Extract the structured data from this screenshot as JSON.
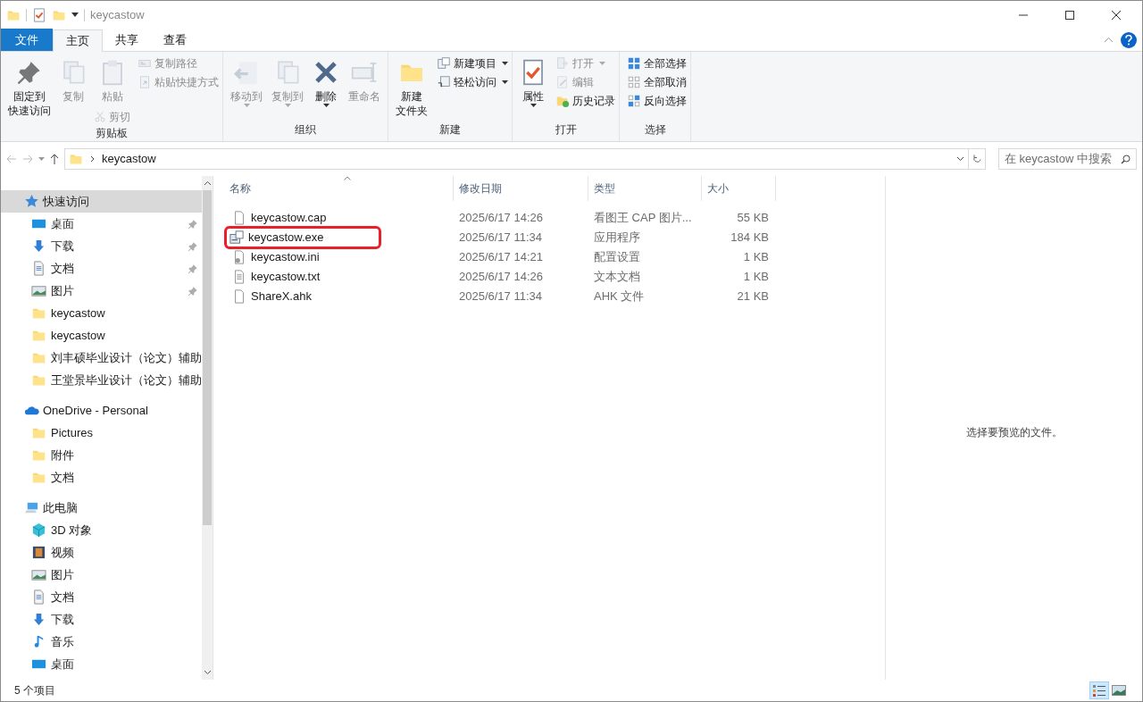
{
  "window": {
    "title": "keycastow"
  },
  "tabs": [
    {
      "label": "文件",
      "kind": "file",
      "selected": false
    },
    {
      "label": "主页",
      "kind": "tab",
      "selected": true
    },
    {
      "label": "共享",
      "kind": "tab",
      "selected": false
    },
    {
      "label": "查看",
      "kind": "tab",
      "selected": false
    }
  ],
  "ribbon": [
    {
      "label": "剪贴板",
      "items": [
        {
          "kind": "large",
          "label": [
            "固定到",
            "快速访问"
          ],
          "disabled": false,
          "dropdown": false
        },
        {
          "kind": "large",
          "label": [
            "复制"
          ],
          "disabled": true,
          "dropdown": false
        },
        {
          "kind": "large",
          "label": [
            "粘贴"
          ],
          "disabled": true,
          "dropdown": false,
          "sub": {
            "label": "剪切",
            "disabled": true
          }
        },
        {
          "kind": "smallcol",
          "items": [
            {
              "label": "复制路径",
              "disabled": true,
              "dropdown": false
            },
            {
              "label": "粘贴快捷方式",
              "disabled": true,
              "dropdown": false
            }
          ]
        }
      ]
    },
    {
      "label": "组织",
      "items": [
        {
          "kind": "large",
          "label": [
            "移动到"
          ],
          "disabled": true,
          "dropdown": true
        },
        {
          "kind": "large",
          "label": [
            "复制到"
          ],
          "disabled": true,
          "dropdown": true
        },
        {
          "kind": "large",
          "label": [
            "删除"
          ],
          "disabled": false,
          "dropdown": true
        },
        {
          "kind": "large",
          "label": [
            "重命名"
          ],
          "disabled": true,
          "dropdown": false
        }
      ]
    },
    {
      "label": "新建",
      "items": [
        {
          "kind": "large",
          "label": [
            "新建",
            "文件夹"
          ],
          "disabled": false,
          "dropdown": false
        },
        {
          "kind": "smallcol",
          "items": [
            {
              "label": "新建项目",
              "disabled": false,
              "dropdown": true
            },
            {
              "label": "轻松访问",
              "disabled": false,
              "dropdown": true
            }
          ]
        }
      ]
    },
    {
      "label": "打开",
      "items": [
        {
          "kind": "large",
          "label": [
            "属性"
          ],
          "disabled": false,
          "dropdown": true
        },
        {
          "kind": "smallcol",
          "items": [
            {
              "label": "打开",
              "disabled": true,
              "dropdown": true
            },
            {
              "label": "编辑",
              "disabled": true,
              "dropdown": false
            },
            {
              "label": "历史记录",
              "disabled": false,
              "dropdown": false
            }
          ]
        }
      ]
    },
    {
      "label": "选择",
      "items": [
        {
          "kind": "smallcol",
          "items": [
            {
              "label": "全部选择",
              "disabled": false,
              "dropdown": false
            },
            {
              "label": "全部取消",
              "disabled": false,
              "dropdown": false
            },
            {
              "label": "反向选择",
              "disabled": false,
              "dropdown": false
            }
          ]
        }
      ]
    }
  ],
  "address": {
    "path": "keycastow",
    "search_placeholder": "在 keycastow 中搜索"
  },
  "sidebar": {
    "items": [
      {
        "kind": "section",
        "label": "快速访问",
        "selected": true,
        "pinned": false
      },
      {
        "kind": "item",
        "label": "桌面",
        "selected": false,
        "pinned": true
      },
      {
        "kind": "item",
        "label": "下载",
        "selected": false,
        "pinned": true
      },
      {
        "kind": "item",
        "label": "文档",
        "selected": false,
        "pinned": true
      },
      {
        "kind": "item",
        "label": "图片",
        "selected": false,
        "pinned": true
      },
      {
        "kind": "item",
        "label": "keycastow",
        "selected": false,
        "pinned": false
      },
      {
        "kind": "item",
        "label": "keycastow",
        "selected": false,
        "pinned": false
      },
      {
        "kind": "item",
        "label": "刘丰硕毕业设计（论文）辅助",
        "selected": false,
        "pinned": false
      },
      {
        "kind": "item",
        "label": "王堂景毕业设计（论文）辅助",
        "selected": false,
        "pinned": false
      },
      {
        "kind": "section",
        "label": "OneDrive - Personal",
        "selected": false,
        "pinned": false
      },
      {
        "kind": "item",
        "label": "Pictures",
        "selected": false,
        "pinned": false
      },
      {
        "kind": "item",
        "label": "附件",
        "selected": false,
        "pinned": false
      },
      {
        "kind": "item",
        "label": "文档",
        "selected": false,
        "pinned": false
      },
      {
        "kind": "section",
        "label": "此电脑",
        "selected": false,
        "pinned": false
      },
      {
        "kind": "item",
        "label": "3D 对象",
        "selected": false,
        "pinned": false
      },
      {
        "kind": "item",
        "label": "视频",
        "selected": false,
        "pinned": false
      },
      {
        "kind": "item",
        "label": "图片",
        "selected": false,
        "pinned": false
      },
      {
        "kind": "item",
        "label": "文档",
        "selected": false,
        "pinned": false
      },
      {
        "kind": "item",
        "label": "下载",
        "selected": false,
        "pinned": false
      },
      {
        "kind": "item",
        "label": "音乐",
        "selected": false,
        "pinned": false
      },
      {
        "kind": "item",
        "label": "桌面",
        "selected": false,
        "pinned": false
      }
    ]
  },
  "table": {
    "columns": [
      "名称",
      "修改日期",
      "类型",
      "大小"
    ],
    "rows": [
      {
        "name": "keycastow.cap",
        "date": "2025/6/17 14:26",
        "type": "看图王 CAP 图片...",
        "size": "55 KB",
        "annotated": false
      },
      {
        "name": "keycastow.exe",
        "date": "2025/6/17 11:34",
        "type": "应用程序",
        "size": "184 KB",
        "annotated": true
      },
      {
        "name": "keycastow.ini",
        "date": "2025/6/17 14:21",
        "type": "配置设置",
        "size": "1 KB",
        "annotated": false
      },
      {
        "name": "keycastow.txt",
        "date": "2025/6/17 14:26",
        "type": "文本文档",
        "size": "1 KB",
        "annotated": false
      },
      {
        "name": "ShareX.ahk",
        "date": "2025/6/17 11:34",
        "type": "AHK 文件",
        "size": "21 KB",
        "annotated": false
      }
    ]
  },
  "preview": {
    "message": "选择要预览的文件。"
  },
  "status_bar": {
    "count": "5 个项目",
    "views": [
      {
        "kind": "details",
        "selected": true
      },
      {
        "kind": "thumbs",
        "selected": false
      }
    ]
  }
}
